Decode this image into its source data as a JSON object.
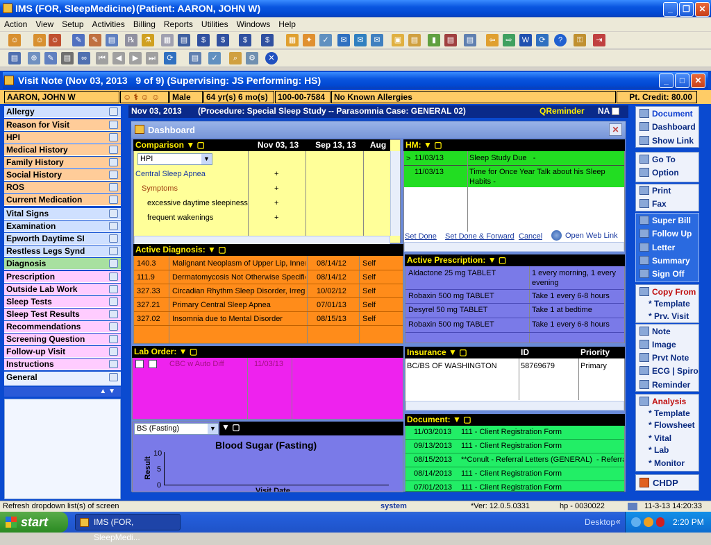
{
  "app": {
    "title": "IMS (FOR, SleepMedicine)",
    "patient": "(Patient: AARON, JOHN W)"
  },
  "menu": [
    "Action",
    "View",
    "Setup",
    "Activities",
    "Billing",
    "Reports",
    "Utilities",
    "Windows",
    "Help"
  ],
  "visit": {
    "title": "Visit Note (Nov 03, 2013   9 of 9) (Supervising: JS Performing: HS)"
  },
  "patient": {
    "name": "AARON, JOHN W",
    "sex": "Male",
    "age": "64 yr(s) 6 mo(s)",
    "id": "100-00-7584",
    "allergies": "No Known Allergies",
    "credit": "Pt. Credit: 80.00"
  },
  "header": {
    "date": "Nov 03, 2013",
    "procedure": "(Procedure:  Special Sleep Study -- Parasomnia  Case: GENERAL 02)",
    "qreminder": "QReminder",
    "na": "NA"
  },
  "nav": [
    "Allergy",
    "Reason for Visit",
    "HPI",
    "Medical History",
    "Family History",
    "Social History",
    "ROS",
    "Current Medication",
    "Vital Signs",
    "Examination",
    "Epworth Daytime SI",
    "Restless Legs Synd",
    "Diagnosis",
    "Prescription",
    "Outside Lab Work",
    "Sleep Tests",
    "Sleep Test Results",
    "Recommendations",
    "Screening Question",
    "Follow-up Visit",
    "Instructions",
    "General"
  ],
  "dashboard": {
    "title": "Dashboard",
    "comparison": {
      "label": "Comparison",
      "dates": [
        "Nov 03, 13",
        "Sep 13, 13",
        "Aug"
      ],
      "select": "HPI",
      "rows": [
        {
          "text": "Central Sleep Apnea",
          "mark": "+"
        },
        {
          "text": "Symptoms",
          "mark": "+"
        },
        {
          "text": "excessive daytime sleepiness",
          "mark": "+"
        },
        {
          "text": "frequent wakenings",
          "mark": "+"
        }
      ]
    },
    "hm": {
      "label": "HM:",
      "rows": [
        {
          "date": "11/03/13",
          "text": "Sleep Study Due   -"
        },
        {
          "date": "11/03/13",
          "text": "Time for Once Year Talk about his Sleep Habits   -"
        }
      ],
      "links": [
        "Set Done",
        "Set Done & Forward",
        "Cancel",
        "Open Web Link"
      ]
    },
    "diagnosis": {
      "label": "Active Diagnosis:",
      "rows": [
        {
          "code": "140.3",
          "desc": "Malignant Neoplasm of Upper Lip, Inner A",
          "date": "08/14/12",
          "by": "Self"
        },
        {
          "code": "111.9",
          "desc": "Dermatomycosis Not Otherwise Specified",
          "date": "08/14/12",
          "by": "Self"
        },
        {
          "code": "327.33",
          "desc": "Circadian Rhythm Sleep Disorder, Irregular",
          "date": "10/02/12",
          "by": "Self"
        },
        {
          "code": "327.21",
          "desc": "Primary Central Sleep Apnea",
          "date": "07/01/13",
          "by": "Self"
        },
        {
          "code": "327.02",
          "desc": "Insomnia due to Mental Disorder",
          "date": "08/15/13",
          "by": "Self"
        }
      ]
    },
    "prescription": {
      "label": "Active Prescription:",
      "rows": [
        {
          "drug": "Aldactone 25 mg TABLET",
          "sig": "1 every morning,  1 every evening"
        },
        {
          "drug": "Robaxin 500 mg TABLET",
          "sig": "Take 1 every 6-8 hours"
        },
        {
          "drug": "Desyrel 50 mg TABLET",
          "sig": "Take 1 at bedtime"
        },
        {
          "drug": "Robaxin 500 mg TABLET",
          "sig": "Take 1 every 6-8 hours"
        }
      ]
    },
    "lab": {
      "label": "Lab Order:",
      "rows": [
        {
          "test": "CBC w Auto Diff",
          "date": "11/03/13"
        }
      ]
    },
    "insurance": {
      "label": "Insurance",
      "cols": [
        "ID",
        "Priority"
      ],
      "rows": [
        {
          "name": "BC/BS OF WASHINGTON",
          "id": "58769679",
          "priority": "Primary"
        }
      ]
    },
    "graph": {
      "select": "BS (Fasting)",
      "title": "Blood Sugar (Fasting)",
      "ylabel": "Result",
      "yticks": [
        "10",
        "5",
        "0"
      ],
      "xlabel": "Visit Date"
    },
    "document": {
      "label": "Document:",
      "rows": [
        {
          "date": "11/03/2013",
          "text": "111 - Client Registration Form"
        },
        {
          "date": "09/13/2013",
          "text": "111 - Client Registration Form"
        },
        {
          "date": "08/15/2013",
          "text": "**Conult - Referral Letters (GENERAL)  - Referral L"
        },
        {
          "date": "08/14/2013",
          "text": "111 - Client Registration Form"
        },
        {
          "date": "07/01/2013",
          "text": "111 - Client Registration Form"
        }
      ]
    }
  },
  "right": {
    "g1": [
      "Document",
      "Dashboard",
      "Show Link"
    ],
    "g2": [
      "Go To",
      "Option"
    ],
    "g3": [
      "Print",
      "Fax"
    ],
    "g4": [
      "Super Bill",
      "Follow Up",
      "Letter",
      "Summary",
      "Sign Off"
    ],
    "g5": [
      "Copy From",
      "* Template",
      "* Prv. Visit"
    ],
    "g6": [
      "Note",
      "Image",
      "Prvt Note",
      "ECG | Spiro",
      "Reminder"
    ],
    "g7": [
      "Analysis",
      "* Template",
      "* Flowsheet",
      "* Vital",
      "* Lab",
      "* Monitor"
    ],
    "chdp": "CHDP"
  },
  "status": {
    "msg": "Refresh dropdown list(s) of screen",
    "user": "system",
    "ver": "*Ver: 12.0.5.0331",
    "host": "hp - 0030022",
    "time": "11-3-13 14:20:33"
  },
  "taskbar": {
    "start": "start",
    "task": "IMS (FOR, SleepMedi...",
    "desktop": "Desktop",
    "clock": "2:20 PM"
  }
}
